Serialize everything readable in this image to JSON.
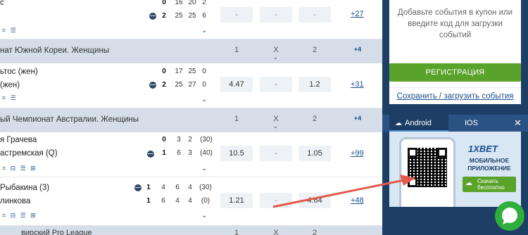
{
  "matches": [
    {
      "team1": "с",
      "team2": "",
      "s1": [
        "0",
        "16",
        "20",
        "2"
      ],
      "s2": [
        "2",
        "25",
        "25",
        "6"
      ],
      "odds": [
        "-",
        "-",
        "-"
      ],
      "more": "+27",
      "icons": "⌗ ☰"
    },
    {
      "team1": "ьтос (жен)",
      "team2": "(жен)",
      "s1": [
        "0",
        "17",
        "25",
        "0"
      ],
      "s2": [
        "2",
        "25",
        "27",
        "0"
      ],
      "odds": [
        "4.47",
        "-",
        "1.2"
      ],
      "more": "+31",
      "icons": "⌗ ☰"
    },
    {
      "team1": "я Грачева",
      "team2": "астремская (Q)",
      "s1": [
        "0",
        "3",
        "2",
        "(30)"
      ],
      "s2": [
        "1",
        "6",
        "3",
        "(40)"
      ],
      "odds": [
        "10.5",
        "-",
        "1.05"
      ],
      "more": "+99",
      "icons": "⌗ ⊟ ☰ ⊞"
    },
    {
      "team1": "Рыбакина (3)",
      "team2": "линкова",
      "s1": [
        "1",
        "4",
        "6",
        "4",
        "(30)"
      ],
      "s2": [
        "1",
        "6",
        "4",
        "4",
        "(0)"
      ],
      "odds": [
        "1.21",
        "-",
        "4.64"
      ],
      "more": "+48",
      "icons": "⌗ ⊟ ☰ ⊞"
    }
  ],
  "leagues": [
    {
      "name": "нат Южной Кореи. Женщины",
      "h1": "1",
      "hx": "X",
      "h2": "2",
      "more": "+4"
    },
    {
      "name": "ый Чемпионат Австралии. Женщины",
      "h1": "1",
      "hx": "X",
      "h2": "2",
      "more": "+4"
    },
    {
      "name": "вирский Pro League",
      "h1": "1",
      "hx": "X",
      "h2": "2"
    }
  ],
  "sidebar": {
    "coupon_message": "Добавьте события в купон или введите код для загрузки событий",
    "register_label": "РЕГИСТРАЦИЯ",
    "save_load_label": "Сохранить / загрузить события",
    "tabs": [
      {
        "label": "Android",
        "icon": "android-icon"
      },
      {
        "label": "IOS",
        "icon": "apple-icon"
      }
    ],
    "close_glyph": "✕",
    "promo": {
      "brand": "1XBET",
      "subtitle": "МОБИЛЬНОЕ ПРИЛОЖЕНИЕ",
      "download_label": "Скачать бесплатно"
    }
  },
  "colors": {
    "accent_green": "#5aa32b",
    "sidebar_blue": "#1d3f66",
    "link_blue": "#1a4d8c",
    "header_grey": "#d5dee8",
    "annotation_arrow": "#e25a4a",
    "chat_green": "#2fae3d"
  }
}
